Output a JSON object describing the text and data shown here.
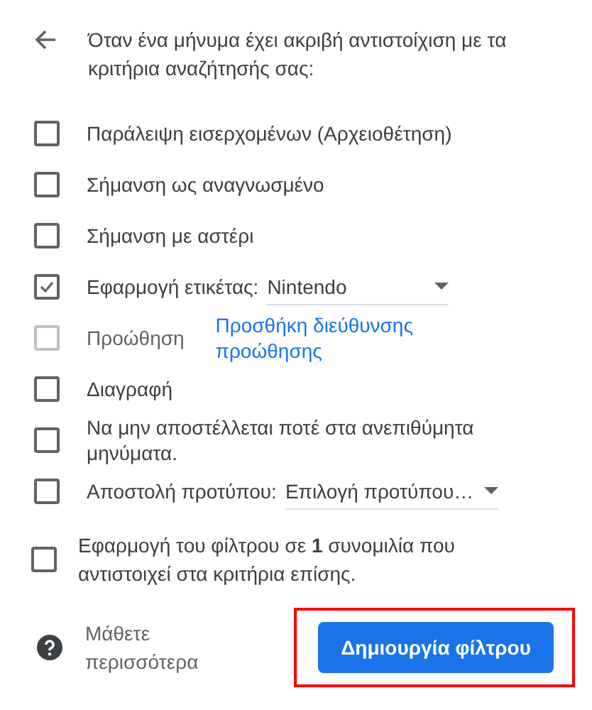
{
  "header": {
    "text": "Όταν ένα μήνυμα έχει ακριβή αντιστοίχιση με τα κριτήρια αναζήτησής σας:"
  },
  "options": [
    {
      "kind": "plain",
      "label": "Παράλειψη εισερχομένων (Αρχειοθέτηση)",
      "checked": false,
      "disabled": false
    },
    {
      "kind": "plain",
      "label": "Σήμανση ως αναγνωσμένο",
      "checked": false,
      "disabled": false
    },
    {
      "kind": "plain",
      "label": "Σήμανση με αστέρι",
      "checked": false,
      "disabled": false
    },
    {
      "kind": "select",
      "label": "Εφαρμογή ετικέτας:",
      "value": "Nintendo",
      "checked": true,
      "disabled": false
    },
    {
      "kind": "link",
      "label": "Προώθηση",
      "link": "Προσθήκη διεύθυνσης προώθησης",
      "checked": false,
      "disabled": true
    },
    {
      "kind": "plain",
      "label": "Διαγραφή",
      "checked": false,
      "disabled": false
    },
    {
      "kind": "plain",
      "label": "Να μην αποστέλλεται ποτέ στα ανεπιθύμητα μηνύματα.",
      "checked": false,
      "disabled": false
    },
    {
      "kind": "select",
      "label": "Αποστολή προτύπου:",
      "value": "Επιλογή προτύπου…",
      "checked": false,
      "disabled": false
    }
  ],
  "apply_existing": {
    "text": "Εφαρμογή του φίλτρου σε **1** συνομιλία που αντιστοιχεί στα κριτήρια επίσης.",
    "checked": false
  },
  "footer": {
    "learn_more": "Μάθετε περισσότερα",
    "create_button": "Δημιουργία φίλτρου",
    "highlighted": true
  }
}
